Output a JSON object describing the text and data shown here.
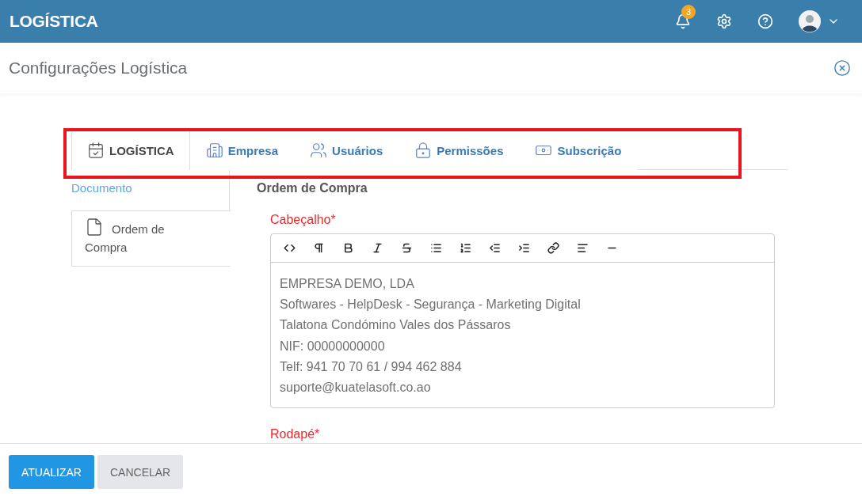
{
  "app": {
    "title": "LOGÍSTICA",
    "notifications": "3"
  },
  "page": {
    "title": "Configurações Logística"
  },
  "tabs": [
    {
      "label": "LOGÍSTICA",
      "selected": true
    },
    {
      "label": "Empresa",
      "selected": false
    },
    {
      "label": "Usuários",
      "selected": false
    },
    {
      "label": "Permissões",
      "selected": false
    },
    {
      "label": "Subscrição",
      "selected": false
    }
  ],
  "sidebar": {
    "heading": "Documento",
    "items": [
      {
        "label": "Ordem de Compra",
        "selected": true
      }
    ]
  },
  "section": {
    "title": "Ordem de Compra"
  },
  "fields": [
    {
      "label": "Cabeçalho*",
      "lines": [
        "EMPRESA DEMO, LDA",
        "Softwares - HelpDesk - Segurança - Marketing Digital",
        "Talatona Condómino Vales dos Pássaros",
        "NIF: 00000000000",
        "Telf: 941 70 70 61 / 994 462 884",
        "suporte@kuatelasoft.co.ao"
      ]
    },
    {
      "label": "Rodapé*"
    }
  ],
  "buttons": [
    {
      "label": "ATUALIZAR",
      "kind": "primary"
    },
    {
      "label": "CANCELAR",
      "kind": "secondary"
    }
  ]
}
